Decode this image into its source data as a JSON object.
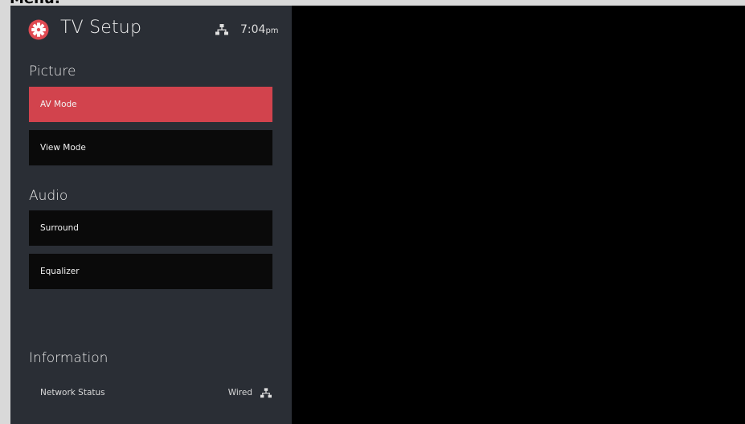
{
  "caption": "Menu:",
  "header": {
    "title": "TV Setup",
    "time": "7:04",
    "time_suffix": "pm",
    "logo_icon": "gear-icon",
    "network_icon": "network-wired-icon"
  },
  "colors": {
    "panel_bg": "#2a2e35",
    "accent": "#d2434d",
    "item_bg": "#0a0a0a",
    "screen_bg": "#000000"
  },
  "sections": [
    {
      "label": "Picture",
      "items": [
        {
          "label": "AV Mode",
          "selected": true
        },
        {
          "label": "View Mode",
          "selected": false
        }
      ]
    },
    {
      "label": "Audio",
      "items": [
        {
          "label": "Surround",
          "selected": false
        },
        {
          "label": "Equalizer",
          "selected": false
        }
      ]
    },
    {
      "label": "Information",
      "rows": [
        {
          "label": "Network Status",
          "value": "Wired",
          "icon": "network-wired-icon"
        }
      ]
    }
  ]
}
